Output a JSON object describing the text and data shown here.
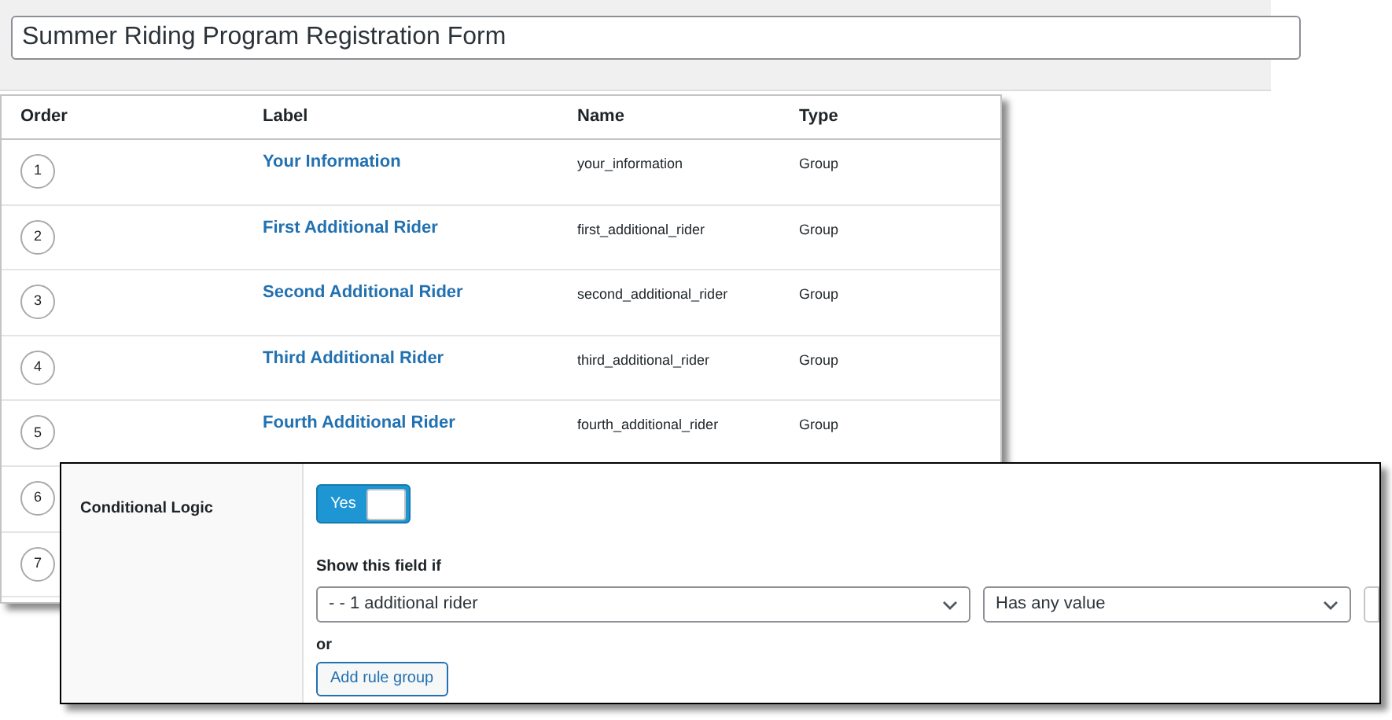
{
  "form_title": {
    "value": "Summer Riding Program Registration Form"
  },
  "fields_table": {
    "columns": [
      "Order",
      "Label",
      "Name",
      "Type"
    ],
    "rows": [
      {
        "order": "1",
        "label": "Your Information",
        "name": "your_information",
        "type": "Group"
      },
      {
        "order": "2",
        "label": "First Additional Rider",
        "name": "first_additional_rider",
        "type": "Group"
      },
      {
        "order": "3",
        "label": "Second Additional Rider",
        "name": "second_additional_rider",
        "type": "Group"
      },
      {
        "order": "4",
        "label": "Third Additional Rider",
        "name": "third_additional_rider",
        "type": "Group"
      },
      {
        "order": "5",
        "label": "Fourth Additional Rider",
        "name": "fourth_additional_rider",
        "type": "Group"
      },
      {
        "order": "6"
      },
      {
        "order": "7"
      }
    ]
  },
  "conditional_logic": {
    "label": "Conditional Logic",
    "toggle": {
      "label": "Yes",
      "on": true
    },
    "rule_heading": "Show this field if",
    "rules": [
      {
        "field": "- - 1 additional rider",
        "operator": "Has any value"
      }
    ],
    "or_label": "or",
    "add_group_button": "Add rule group"
  }
}
